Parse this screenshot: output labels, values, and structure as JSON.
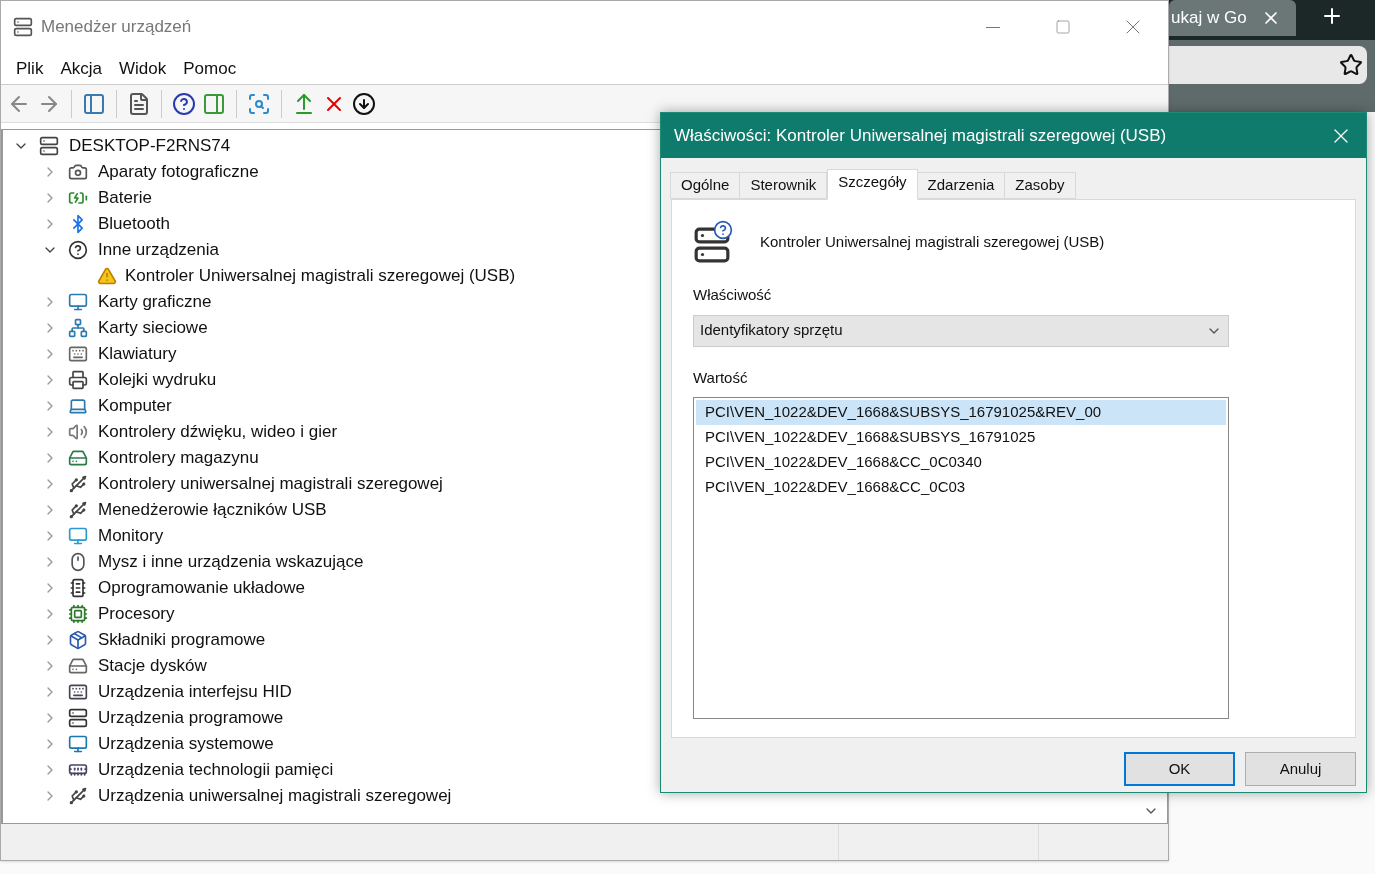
{
  "browser": {
    "tab_title": "ukaj w Go"
  },
  "window": {
    "title": "Menedżer urządzeń"
  },
  "menu": [
    "Plik",
    "Akcja",
    "Widok",
    "Pomoc"
  ],
  "tree": {
    "label": "DESKTOP-F2RNS74",
    "expanded": true,
    "children": [
      {
        "label": "Aparaty fotograficzne",
        "expanded": false
      },
      {
        "label": "Baterie",
        "expanded": false
      },
      {
        "label": "Bluetooth",
        "expanded": false
      },
      {
        "label": "Inne urządzenia",
        "expanded": true,
        "children": [
          {
            "label": "Kontroler Uniwersalnej magistrali szeregowej (USB)",
            "warning": true
          }
        ]
      },
      {
        "label": "Karty graficzne",
        "expanded": false
      },
      {
        "label": "Karty sieciowe",
        "expanded": false
      },
      {
        "label": "Klawiatury",
        "expanded": false
      },
      {
        "label": "Kolejki wydruku",
        "expanded": false
      },
      {
        "label": "Komputer",
        "expanded": false
      },
      {
        "label": "Kontrolery dźwięku, wideo i gier",
        "expanded": false
      },
      {
        "label": "Kontrolery magazynu",
        "expanded": false
      },
      {
        "label": "Kontrolery uniwersalnej magistrali szeregowej",
        "expanded": false
      },
      {
        "label": "Menedżerowie łączników USB",
        "expanded": false
      },
      {
        "label": "Monitory",
        "expanded": false
      },
      {
        "label": "Mysz i inne urządzenia wskazujące",
        "expanded": false
      },
      {
        "label": "Oprogramowanie układowe",
        "expanded": false
      },
      {
        "label": "Procesory",
        "expanded": false
      },
      {
        "label": "Składniki programowe",
        "expanded": false
      },
      {
        "label": "Stacje dysków",
        "expanded": false
      },
      {
        "label": "Urządzenia interfejsu HID",
        "expanded": false
      },
      {
        "label": "Urządzenia programowe",
        "expanded": false
      },
      {
        "label": "Urządzenia systemowe",
        "expanded": false
      },
      {
        "label": "Urządzenia technologii pamięci",
        "expanded": false
      },
      {
        "label": "Urządzenia uniwersalnej magistrali szeregowej",
        "expanded": false
      }
    ]
  },
  "dialog": {
    "title": "Właściwości: Kontroler Uniwersalnej magistrali szeregowej (USB)",
    "tabs": [
      {
        "label": "Ogólne",
        "selected": false
      },
      {
        "label": "Sterownik",
        "selected": false
      },
      {
        "label": "Szczegóły",
        "selected": true
      },
      {
        "label": "Zdarzenia",
        "selected": false
      },
      {
        "label": "Zasoby",
        "selected": false
      }
    ],
    "device_name": "Kontroler Uniwersalnej magistrali szeregowej (USB)",
    "property_label": "Właściwość",
    "property_value": "Identyfikatory sprzętu",
    "value_label": "Wartość",
    "values": [
      {
        "text": "PCI\\VEN_1022&DEV_1668&SUBSYS_16791025&REV_00",
        "selected": true
      },
      {
        "text": "PCI\\VEN_1022&DEV_1668&SUBSYS_16791025",
        "selected": false
      },
      {
        "text": "PCI\\VEN_1022&DEV_1668&CC_0C0340",
        "selected": false
      },
      {
        "text": "PCI\\VEN_1022&DEV_1668&CC_0C03",
        "selected": false
      }
    ],
    "buttons": [
      {
        "label": "OK",
        "default": true
      },
      {
        "label": "Anuluj",
        "default": false
      }
    ]
  }
}
